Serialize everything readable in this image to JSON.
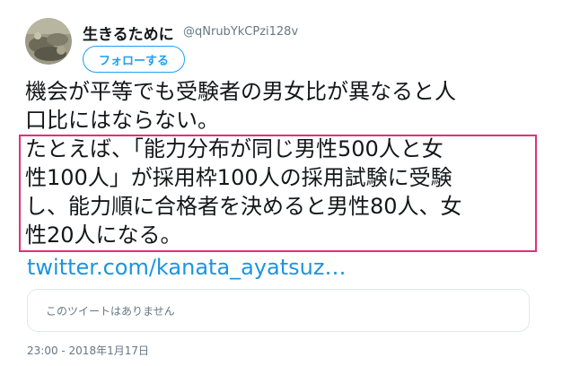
{
  "author": {
    "display_name": "生きるために",
    "handle": "@qNrubYkCPzi128v",
    "avatar_icon": "user-avatar-icon"
  },
  "follow_button": {
    "label": "フォローする",
    "color": "#1da1f2"
  },
  "tweet": {
    "lines": [
      "機会が平等でも受験者の男女比が異なると人",
      "口比にはならない。",
      "たとえば、「能力分布が同じ男性500人と女",
      "性100人」が採用枠100人の採用試験に受験",
      "し、能力順に合格者を決めると男性80人、女",
      "性20人になる。"
    ],
    "link_text": "twitter.com/kanata_ayatsuz…",
    "highlight_color": "#e0307a",
    "link_color": "#1b95e0"
  },
  "quoted_tweet": {
    "unavailable_text": "このツイートはありません"
  },
  "timestamp": "23:00 - 2018年1月17日"
}
